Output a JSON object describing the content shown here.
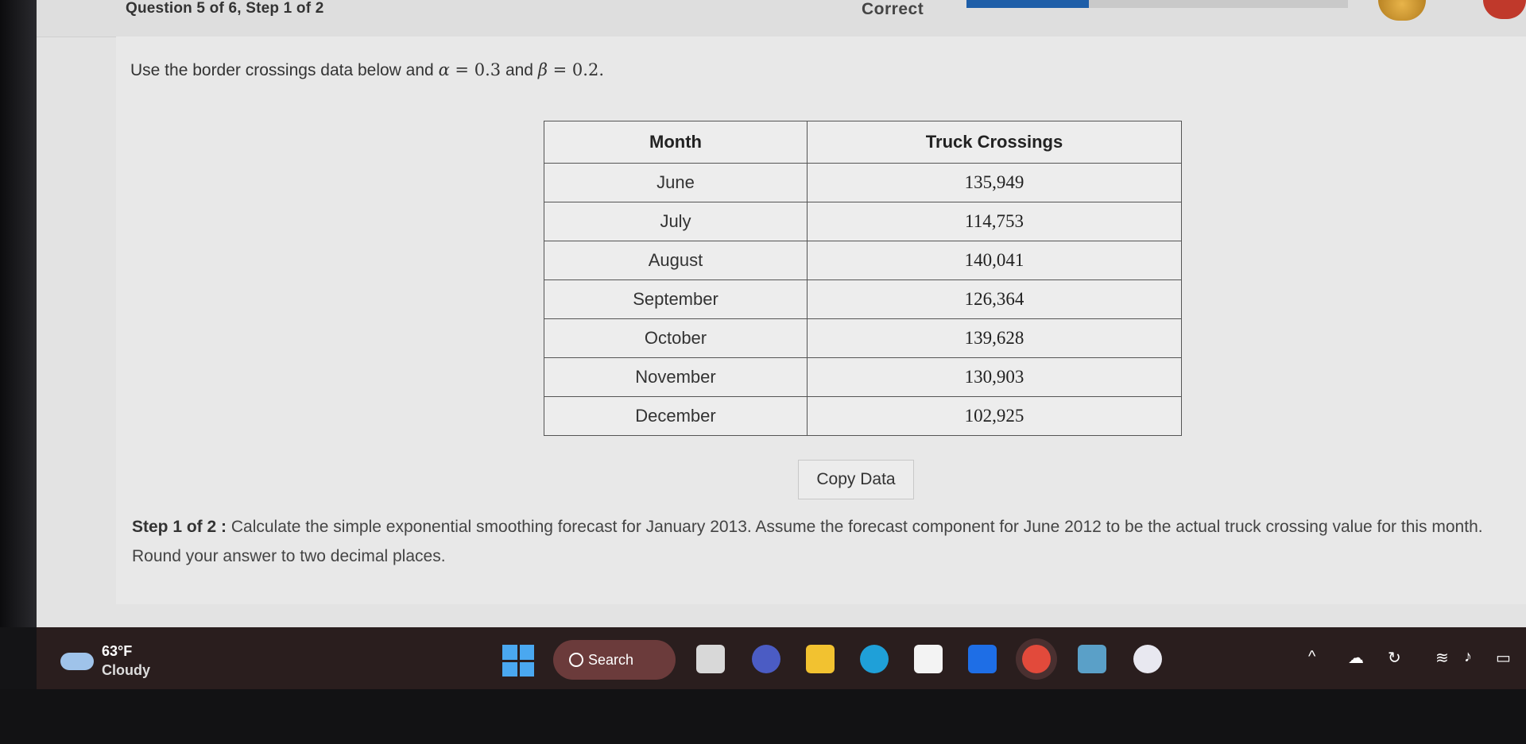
{
  "header": {
    "question_step": "Question 5 of 6, Step 1 of 2",
    "status": "Correct",
    "progress_fraction": 0.32,
    "accent_color": "#1e5ea8"
  },
  "prompt": {
    "text_before": "Use the border crossings data below and ",
    "alpha_symbol": "α",
    "equals1": " = ",
    "alpha_value": "0.3",
    "and_text": " and ",
    "beta_symbol": "β",
    "equals2": " = ",
    "beta_value": "0.2",
    "end": "."
  },
  "table": {
    "columns": [
      "Month",
      "Truck Crossings"
    ],
    "rows": [
      {
        "month": "June",
        "value": "135,949"
      },
      {
        "month": "July",
        "value": "114,753"
      },
      {
        "month": "August",
        "value": "140,041"
      },
      {
        "month": "September",
        "value": "126,364"
      },
      {
        "month": "October",
        "value": "139,628"
      },
      {
        "month": "November",
        "value": "130,903"
      },
      {
        "month": "December",
        "value": "102,925"
      }
    ]
  },
  "copy_button_label": "Copy Data",
  "step": {
    "label": "Step 1 of 2 :",
    "text": " Calculate the simple exponential smoothing forecast for January 2013. Assume the forecast component for June 2012 to be the actual truck crossing value for this month. Round your answer to two decimal places."
  },
  "taskbar": {
    "temperature": "63°F",
    "condition": "Cloudy",
    "search_label": "Search",
    "apps": [
      "widgets-icon",
      "meet-icon",
      "file-explorer-icon",
      "edge-icon",
      "store-icon",
      "dropbox-icon",
      "chrome-icon",
      "calculator-icon",
      "app-icon"
    ]
  }
}
